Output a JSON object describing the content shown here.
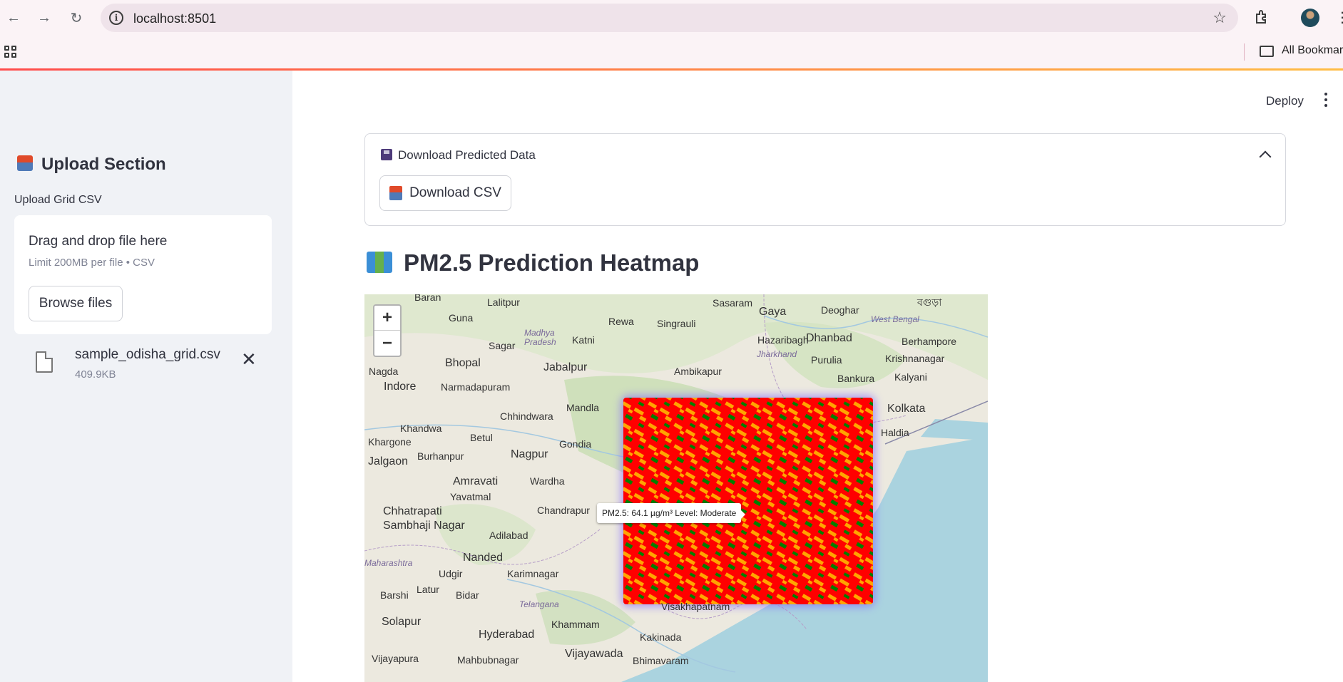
{
  "browser": {
    "url": "localhost:8501",
    "bookmarks_label": "All Bookmarks"
  },
  "sidebar": {
    "title": "Upload Section",
    "upload_label": "Upload Grid CSV",
    "dropzone_title": "Drag and drop file here",
    "dropzone_limit": "Limit 200MB per file • CSV",
    "browse_button": "Browse files",
    "file_name": "sample_odisha_grid.csv",
    "file_size": "409.9KB"
  },
  "header": {
    "deploy": "Deploy"
  },
  "expander": {
    "label": "Download Predicted Data",
    "download_button": "Download CSV"
  },
  "main": {
    "heading": "PM2.5 Prediction Heatmap"
  },
  "map": {
    "tooltip": "PM2.5: 64.1 µg/m³ Level: Moderate",
    "zoom_in": "+",
    "zoom_out": "−",
    "places": [
      {
        "name": "Baran",
        "big": false
      },
      {
        "name": "Lalitpur",
        "big": false
      },
      {
        "name": "Rewa",
        "big": false
      },
      {
        "name": "Sasaram",
        "big": false
      },
      {
        "name": "Gaya",
        "big": true
      },
      {
        "name": "Deoghar",
        "big": false
      },
      {
        "name": "বগুড়া",
        "big": false
      },
      {
        "name": "Guna",
        "big": false
      },
      {
        "name": "Singrauli",
        "big": false
      },
      {
        "name": "Sagar",
        "big": false
      },
      {
        "name": "Katni",
        "big": false
      },
      {
        "name": "Hazaribagh",
        "big": false
      },
      {
        "name": "Dhanbad",
        "big": true
      },
      {
        "name": "Berhampore",
        "big": false
      },
      {
        "name": "Bhopal",
        "big": true
      },
      {
        "name": "Jabalpur",
        "big": true
      },
      {
        "name": "Purulia",
        "big": false
      },
      {
        "name": "Krishnanagar",
        "big": false
      },
      {
        "name": "Nagda",
        "big": false
      },
      {
        "name": "Ambikapur",
        "big": false
      },
      {
        "name": "Bankura",
        "big": false
      },
      {
        "name": "Kalyani",
        "big": false
      },
      {
        "name": "Indore",
        "big": true
      },
      {
        "name": "Narmadapuram",
        "big": false
      },
      {
        "name": "Mandla",
        "big": false
      },
      {
        "name": "Kolkata",
        "big": true
      },
      {
        "name": "Chhindwara",
        "big": false
      },
      {
        "name": "Khandwa",
        "big": false
      },
      {
        "name": "Betul",
        "big": false
      },
      {
        "name": "Haldia",
        "big": false
      },
      {
        "name": "Khargone",
        "big": false
      },
      {
        "name": "Gondia",
        "big": false
      },
      {
        "name": "Nagpur",
        "big": true
      },
      {
        "name": "Jalgaon",
        "big": true
      },
      {
        "name": "Burhanpur",
        "big": false
      },
      {
        "name": "Amravati",
        "big": true
      },
      {
        "name": "Wardha",
        "big": false
      },
      {
        "name": "Yavatmal",
        "big": false
      },
      {
        "name": "Chhatrapati",
        "big": true
      },
      {
        "name": "Sambhaji Nagar",
        "big": true
      },
      {
        "name": "Chandrapur",
        "big": false
      },
      {
        "name": "Adilabad",
        "big": false
      },
      {
        "name": "Nanded",
        "big": true
      },
      {
        "name": "Udgir",
        "big": false
      },
      {
        "name": "Karimnagar",
        "big": false
      },
      {
        "name": "Barshi",
        "big": false
      },
      {
        "name": "Latur",
        "big": false
      },
      {
        "name": "Bidar",
        "big": false
      },
      {
        "name": "Solapur",
        "big": true
      },
      {
        "name": "Hyderabad",
        "big": true
      },
      {
        "name": "Khammam",
        "big": false
      },
      {
        "name": "Kakinada",
        "big": false
      },
      {
        "name": "Vijayapura",
        "big": false
      },
      {
        "name": "Mahbubnagar",
        "big": false
      },
      {
        "name": "Vijayawada",
        "big": true
      },
      {
        "name": "Bhimavaram",
        "big": false
      },
      {
        "name": "Visakhapatnam",
        "big": false
      }
    ],
    "states": [
      "Madhya Pradesh",
      "Jharkhand",
      "West Bengal",
      "Maharashtra",
      "Telangana"
    ],
    "heatmap_colors": {
      "high": "#ff0000",
      "moderate": "#ffa500",
      "good": "#008000"
    }
  }
}
